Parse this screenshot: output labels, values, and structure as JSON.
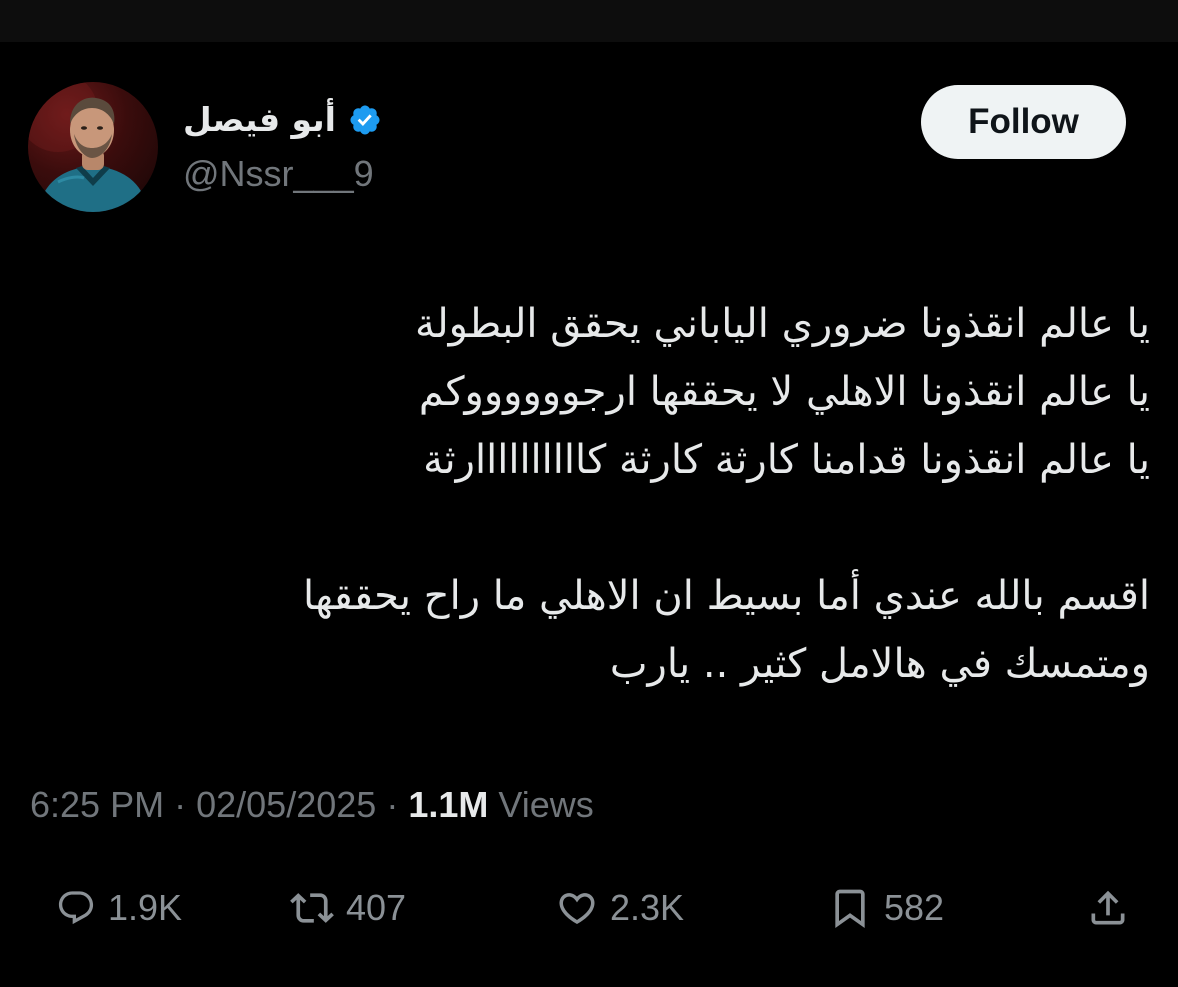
{
  "user": {
    "display_name": "أبو فيصل",
    "handle": "@Nssr___9",
    "verified": true
  },
  "follow_button": {
    "label": "Follow"
  },
  "tweet": {
    "lines": [
      "يا عالم انقذونا ضروري الياباني يحقق البطولة",
      "يا عالم انقذونا الاهلي لا يحققها ارجووووووكم",
      "يا عالم انقذونا قدامنا كارثة كارثة كاااااااااارثة",
      "",
      "اقسم بالله عندي أما بسيط ان الاهلي ما راح يحققها",
      "ومتمسك في هالامل كثير .. يارب"
    ]
  },
  "meta": {
    "time": "6:25 PM",
    "separator": "·",
    "date": "02/05/2025",
    "views_count": "1.1M",
    "views_label": "Views"
  },
  "actions": {
    "replies": "1.9K",
    "reposts": "407",
    "likes": "2.3K",
    "bookmarks": "582"
  },
  "icons": {
    "verified": "verified-badge-icon",
    "reply": "speech-bubble-icon",
    "repost": "repost-arrows-icon",
    "like": "heart-icon",
    "bookmark": "bookmark-icon",
    "share": "share-upload-icon"
  },
  "colors": {
    "background": "#000000",
    "text_primary": "#e7e9ea",
    "text_secondary": "#71767b",
    "verified_blue": "#1d9bf0",
    "follow_button_bg": "#eff3f4",
    "follow_button_text": "#0f1419"
  }
}
